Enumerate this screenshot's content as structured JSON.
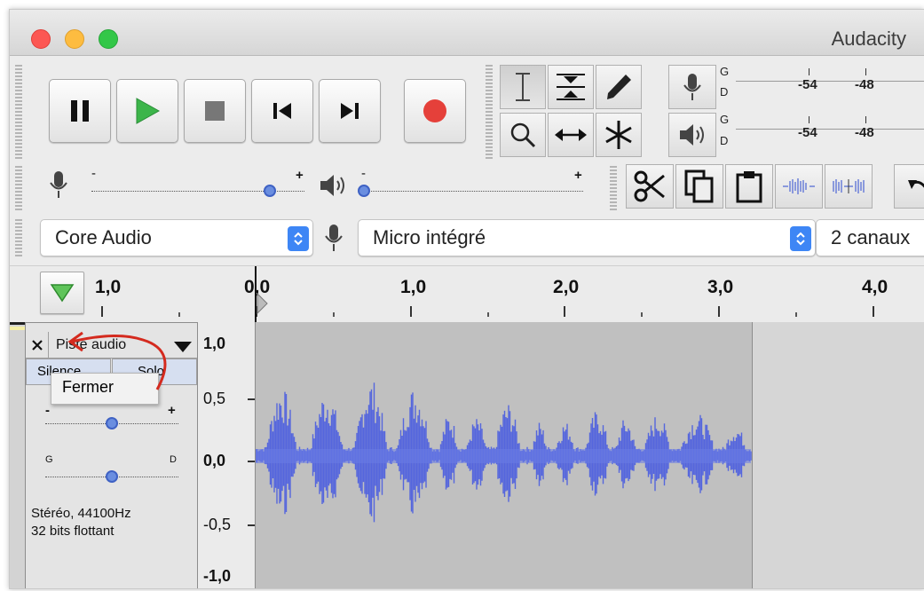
{
  "window": {
    "title": "Audacity"
  },
  "meters": {
    "record_left": "G",
    "record_right": "D",
    "play_left": "G",
    "play_right": "D",
    "scale": [
      "-54",
      "-48"
    ]
  },
  "devices": {
    "host": "Core Audio",
    "input": "Micro intégré",
    "channels": "2 canaux"
  },
  "ruler": {
    "labels": [
      "1,0",
      "0,0",
      "1,0",
      "2,0",
      "3,0",
      "4,0"
    ]
  },
  "track": {
    "name": "Piste audio",
    "mute_label": "Silence",
    "solo_label": "Solo",
    "tooltip": "Fermer",
    "gain_minus": "-",
    "gain_plus": "+",
    "pan_left": "G",
    "pan_right": "D",
    "gain_level": 0.5,
    "pan_level": 0.5,
    "info_line1": "Stéréo, 44100Hz",
    "info_line2": "32 bits flottant"
  },
  "vertical_scale": [
    "1,0",
    "0,5",
    "0,0",
    "-0,5",
    "-1,0"
  ],
  "colors": {
    "waveform": "#5566dd",
    "record": "#e5403a",
    "play": "#3cb54a",
    "annotation": "#d42a1e"
  }
}
